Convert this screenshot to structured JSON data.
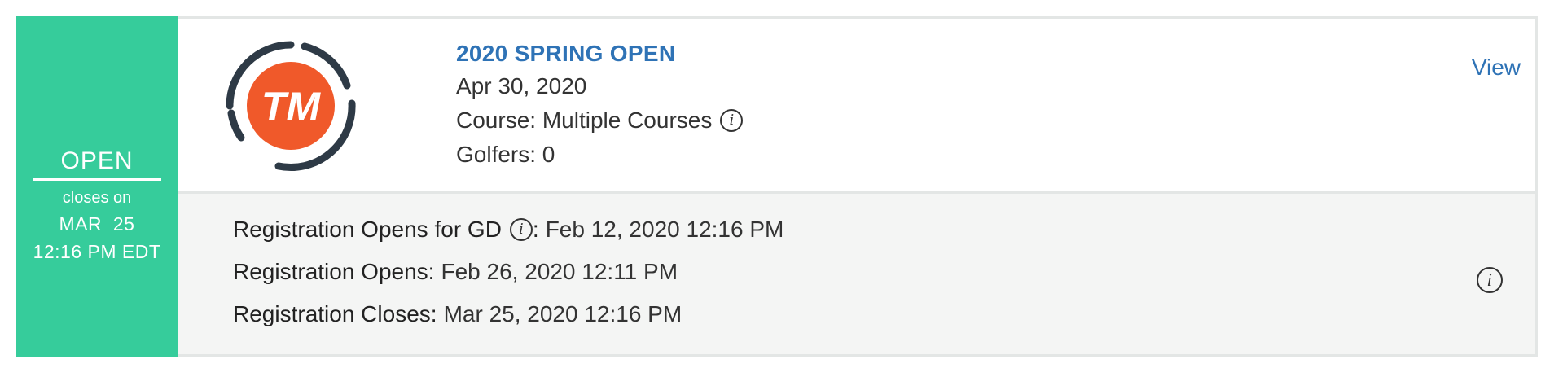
{
  "status": {
    "label": "OPEN",
    "sub_label": "closes on",
    "date": "MAR  25",
    "time": "12:16 PM EDT",
    "color": "#36cc9b"
  },
  "event": {
    "logo_text": "TM",
    "title": "2020 SPRING OPEN",
    "date": "Apr 30, 2020",
    "course": "Course: Multiple Courses",
    "golfers": "Golfers: 0",
    "view_label": "View",
    "link_color": "#2f73b6",
    "logo_color": "#f0592a"
  },
  "registration": {
    "opens_gd_label": "Registration Opens for GD",
    "opens_gd_value": "Feb 12, 2020 12:16 PM",
    "opens_label": "Registration Opens:",
    "opens_value": "Feb 26, 2020 12:11 PM",
    "closes_label": "Registration Closes:",
    "closes_value": "Mar 25, 2020 12:16 PM"
  },
  "icons": {
    "info": "i"
  }
}
